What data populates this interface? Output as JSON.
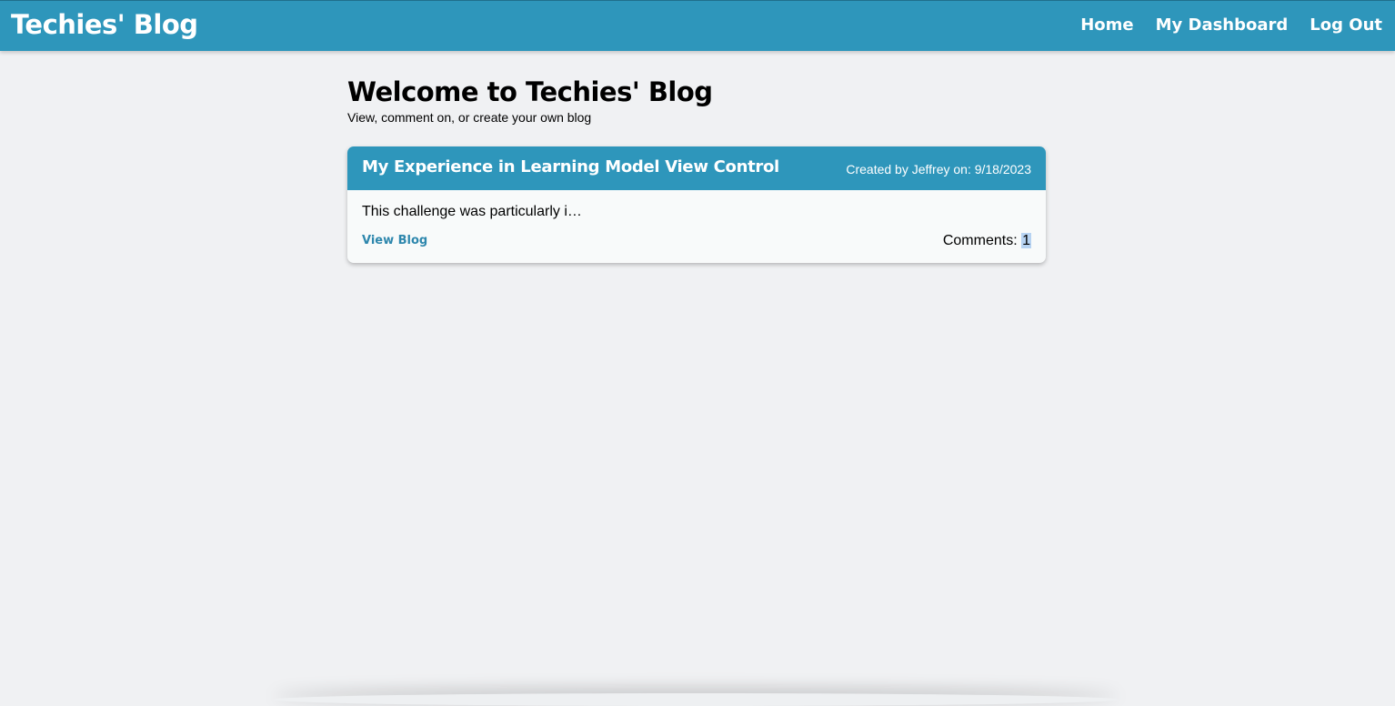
{
  "header": {
    "brand": "Techies' Blog",
    "nav": {
      "home": "Home",
      "dashboard": "My Dashboard",
      "logout": "Log Out"
    }
  },
  "main": {
    "title": "Welcome to Techies' Blog",
    "subtitle": "View, comment on, or create your own blog",
    "posts": [
      {
        "title": "My Experience in Learning Model View Control",
        "meta": "Created by Jeffrey on: 9/18/2023",
        "excerpt": "This challenge was particularly i…",
        "view_label": "View Blog",
        "comments_label": "Comments:",
        "comments_count": "1"
      }
    ]
  },
  "colors": {
    "accent": "#2e96bb",
    "page_background": "#f0f1f3",
    "card_background": "#f8fafa",
    "link": "#2e87ad",
    "selection_highlight": "#b7d3f2"
  }
}
